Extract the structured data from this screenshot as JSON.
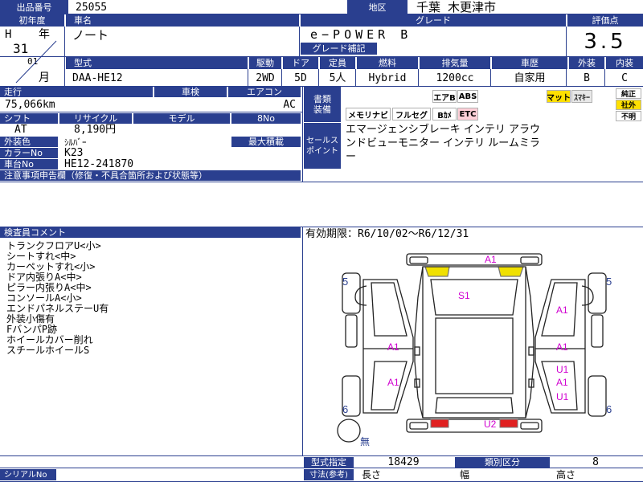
{
  "header": {
    "lot_number_label": "出品番号",
    "lot_number": "25055",
    "region_label": "地区",
    "region": "千葉 木更津市"
  },
  "vehicle": {
    "first_reg_label": "初年度",
    "era": "H",
    "year_label": "年",
    "year": "31",
    "month": "01",
    "month_label": "月",
    "model_name_label": "車名",
    "model_name": "ノート",
    "grade_label": "グレード",
    "grade": "e−POWER B",
    "grade_note_label": "グレード補記",
    "score_label": "評価点",
    "score": "3.5",
    "type_code_label": "型式",
    "type_code": "DAA-HE12",
    "drive_label": "駆動",
    "drive": "2WD",
    "doors_label": "ドア",
    "doors": "5D",
    "capacity_label": "定員",
    "capacity": "5人",
    "fuel_label": "燃料",
    "fuel": "Hybrid",
    "displacement_label": "排気量",
    "displacement": "1200cc",
    "history_label": "車歴",
    "history": "自家用",
    "exterior_label": "外装",
    "exterior": "B",
    "interior_label": "内装",
    "interior": "C",
    "mileage_label": "走行",
    "mileage": "75,066km",
    "inspection_label": "車検",
    "ac_label": "エアコン",
    "ac": "AC",
    "shift_label": "シフト",
    "shift": "AT",
    "recycle_label": "リサイクル",
    "recycle": "8,190円",
    "model_label": "モデル",
    "eight_no_label": "8No",
    "color_label": "外装色",
    "color": "ｼﾙﾊﾞｰ",
    "max_load_label": "最大積載",
    "color_no_label": "カラーNo",
    "color_no": "K23",
    "chassis_label": "車台No",
    "chassis": "HE12-241870",
    "notes_label": "注意事項申告欄（修復・不具合箇所および状態等）"
  },
  "equipment": {
    "label_line1": "書類",
    "label_line2": "装備",
    "row1": [
      "エアB",
      "ABS"
    ],
    "row1_right": [
      "マット",
      "ｽﾏｷｰ"
    ],
    "row2": [
      "メモリナビ",
      "フルセグ",
      "Bｶﾒ",
      "ETC"
    ],
    "side": [
      "純正",
      "社外",
      "不明"
    ]
  },
  "sales": {
    "label_line1": "セールス",
    "label_line2": "ポイント",
    "text_line1": "エマージェンシブレーキ インテリ アラウ",
    "text_line2": "ンドビューモニター インテリ ルームミラ",
    "text_line3": "ー"
  },
  "inspector": {
    "label": "検査員コメント",
    "comments": [
      "トランクフロアU<小>",
      "シートすれ<中>",
      "カーペットすれ<小>",
      "ドア内張りA<中>",
      "ピラー内張りA<中>",
      "コンソールA<小>",
      "エンドパネルステーU有",
      "外装小傷有",
      "FバンパP跡",
      "ホイールカバー削れ",
      "スチールホイールS"
    ]
  },
  "validity": "有効期限：R6/10/02〜R6/12/31",
  "diagram": {
    "marks": {
      "rear": "A1",
      "trunk": "S1",
      "left_rear_quarter": "A1",
      "right_rear_quarter": "A1",
      "left_rear_door": "A1",
      "right_rear_door": "A1",
      "left_front_door": "A1",
      "right_front_u1a": "U1",
      "right_front_a1": "A1",
      "right_front_u1b": "U1",
      "front": "U2"
    },
    "tire_tl": "5",
    "tire_tr": "5",
    "tire_bl": "6",
    "tire_br": "6",
    "spare": "無"
  },
  "footer": {
    "serial_label": "シリアルNo",
    "type_designation_label": "型式指定",
    "type_designation": "18429",
    "class_label": "類別区分",
    "class_value": "8",
    "size_label": "寸法(参考)",
    "length_label": "長さ",
    "width_label": "幅",
    "height_label": "高さ"
  },
  "colors": {
    "label_bg": "#2a3f8f",
    "mark": "#d000d0",
    "tire_num": "#2a3f8f"
  }
}
